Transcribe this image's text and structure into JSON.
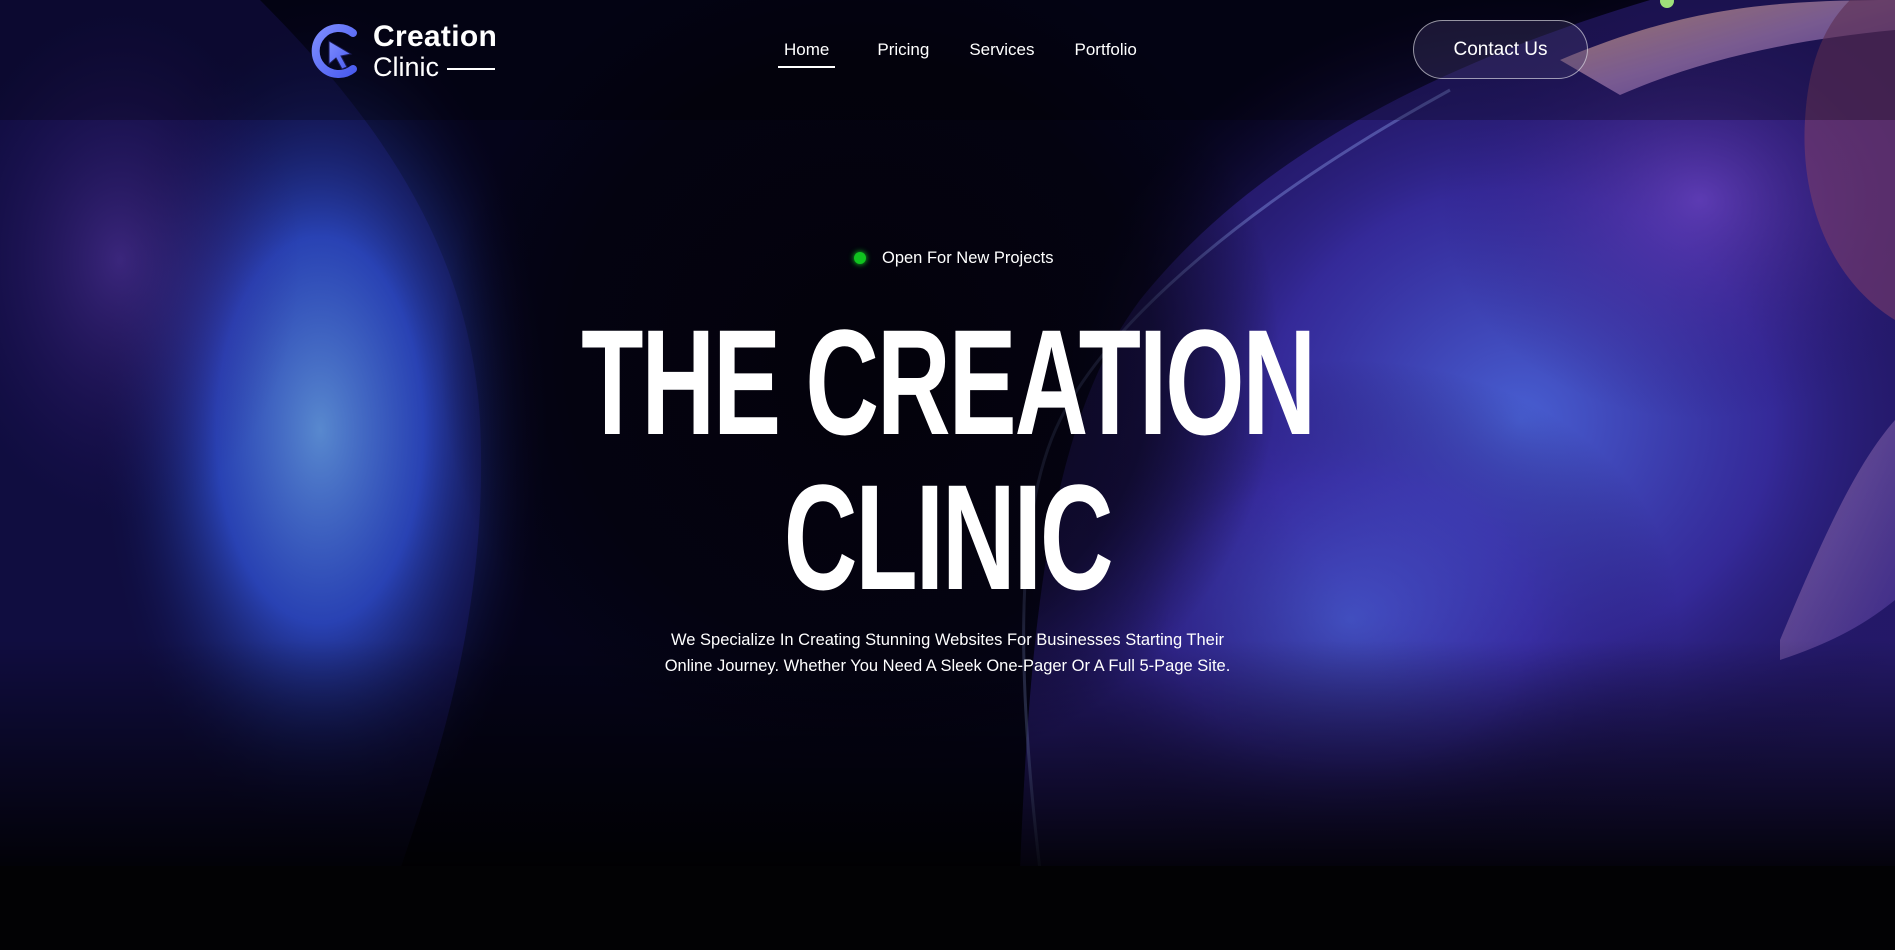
{
  "brand": {
    "name_line1": "Creation",
    "name_line2": "Clinic",
    "logo_icon": "cursor-c-logo-icon"
  },
  "nav": {
    "items": [
      {
        "label": "Home",
        "active": true
      },
      {
        "label": "Pricing",
        "active": false
      },
      {
        "label": "Services",
        "active": false
      },
      {
        "label": "Portfolio",
        "active": false
      }
    ]
  },
  "header": {
    "cta_label": "Contact Us"
  },
  "hero": {
    "status_text": "Open For New Projects",
    "status_color": "#10c21f",
    "title_line1": "THE CREATION",
    "title_line2": "CLINIC",
    "description_line1": "We Specialize In Creating Stunning Websites For Businesses Starting Their",
    "description_line2": "Online Journey. Whether You Need A Sleek One-Pager Or A Full 5-Page Site."
  },
  "colors": {
    "background": "#04030d",
    "accent_blue": "#5a6cff",
    "accent_purple": "#6a3fc0",
    "accent_peach": "#d9a08c"
  }
}
